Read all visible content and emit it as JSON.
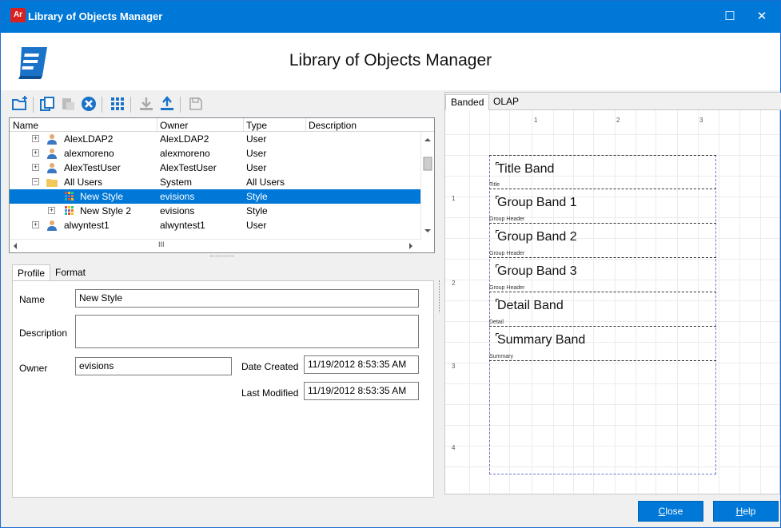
{
  "window": {
    "title": "Library of Objects Manager",
    "app_icon_text": "Ar",
    "maximize_glyph": "☐",
    "close_glyph": "✕"
  },
  "header": {
    "title": "Library of Objects Manager"
  },
  "toolbar": {
    "buttons": [
      "new-folder-icon",
      "copy-icon",
      "paste-icon",
      "delete-icon",
      "grid-icon",
      "download-icon",
      "upload-icon",
      "save-icon"
    ]
  },
  "tree": {
    "columns": [
      "Name",
      "Owner",
      "Type",
      "Description"
    ],
    "rows": [
      {
        "name": "AlexLDAP2",
        "owner": "AlexLDAP2",
        "type": "User",
        "description": "",
        "icon": "user-icon",
        "expander": "+"
      },
      {
        "name": "alexmoreno",
        "owner": "alexmoreno",
        "type": "User",
        "description": "",
        "icon": "user-icon",
        "expander": "+"
      },
      {
        "name": "AlexTestUser",
        "owner": "AlexTestUser",
        "type": "User",
        "description": "",
        "icon": "user-icon",
        "expander": "+"
      },
      {
        "name": "All Users",
        "owner": "System",
        "type": "All Users",
        "description": "",
        "icon": "folder-icon",
        "expander": "−"
      },
      {
        "name": "New Style",
        "owner": "evisions",
        "type": "Style",
        "description": "",
        "icon": "style-icon",
        "expander": ""
      },
      {
        "name": "New Style 2",
        "owner": "evisions",
        "type": "Style",
        "description": "",
        "icon": "style-icon",
        "expander": "+"
      },
      {
        "name": "alwyntest1",
        "owner": "alwyntest1",
        "type": "User",
        "description": "",
        "icon": "user-icon",
        "expander": "+"
      }
    ],
    "hscroll_grip": "III"
  },
  "left_tabs": {
    "profile": "Profile",
    "format": "Format"
  },
  "profile": {
    "name_label": "Name",
    "name_value": "New Style",
    "description_label": "Description",
    "description_value": "",
    "owner_label": "Owner",
    "owner_value": "evisions",
    "date_created_label": "Date Created",
    "date_created_value": "11/19/2012 8:53:35 AM",
    "last_modified_label": "Last Modified",
    "last_modified_value": "11/19/2012 8:53:35 AM"
  },
  "right_tabs": {
    "banded": "Banded",
    "olap": "OLAP"
  },
  "design": {
    "ruler_top": [
      "1",
      "2",
      "3"
    ],
    "ruler_left": [
      "1",
      "2",
      "3",
      "4"
    ],
    "bands": [
      {
        "title": "Title Band",
        "sub": "Title"
      },
      {
        "title": "Group Band 1",
        "sub": "Group Header"
      },
      {
        "title": "Group Band 2",
        "sub": "Group Header"
      },
      {
        "title": "Group Band 3",
        "sub": "Group Header"
      },
      {
        "title": "Detail Band",
        "sub": "Detail"
      },
      {
        "title": "Summary Band",
        "sub": "Summary"
      }
    ]
  },
  "footer": {
    "close_first": "C",
    "close_rest": "lose",
    "help_first": "H",
    "help_rest": "elp"
  }
}
